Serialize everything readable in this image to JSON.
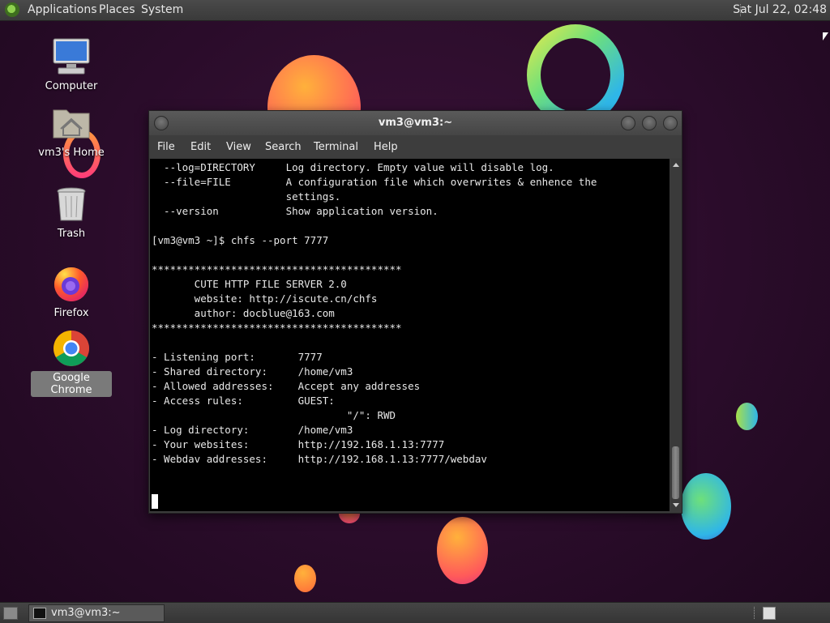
{
  "top_panel": {
    "menus": [
      "Applications",
      "Places",
      "System"
    ],
    "clock": "Sat Jul 22, 02:48"
  },
  "desktop_icons": [
    {
      "label": "Computer"
    },
    {
      "label": "vm3's Home"
    },
    {
      "label": "Trash"
    },
    {
      "label": "Firefox"
    },
    {
      "label": "Google Chrome"
    }
  ],
  "terminal": {
    "title": "vm3@vm3:~",
    "menu": [
      "File",
      "Edit",
      "View",
      "Search",
      "Terminal",
      "Help"
    ],
    "output": "  --log=DIRECTORY     Log directory. Empty value will disable log.\n  --file=FILE         A configuration file which overwrites & enhence the\n                      settings.\n  --version           Show application version.\n\n[vm3@vm3 ~]$ chfs --port 7777\n\n*****************************************\n       CUTE HTTP FILE SERVER 2.0\n       website: http://iscute.cn/chfs\n       author: docblue@163.com\n*****************************************\n\n- Listening port:       7777\n- Shared directory:     /home/vm3\n- Allowed addresses:    Accept any addresses\n- Access rules:         GUEST:\n                                \"/\": RWD\n- Log directory:        /home/vm3\n- Your websites:        http://192.168.1.13:7777\n- Webdav addresses:     http://192.168.1.13:7777/webdav"
  },
  "taskbar": {
    "window_label": "vm3@vm3:~"
  }
}
